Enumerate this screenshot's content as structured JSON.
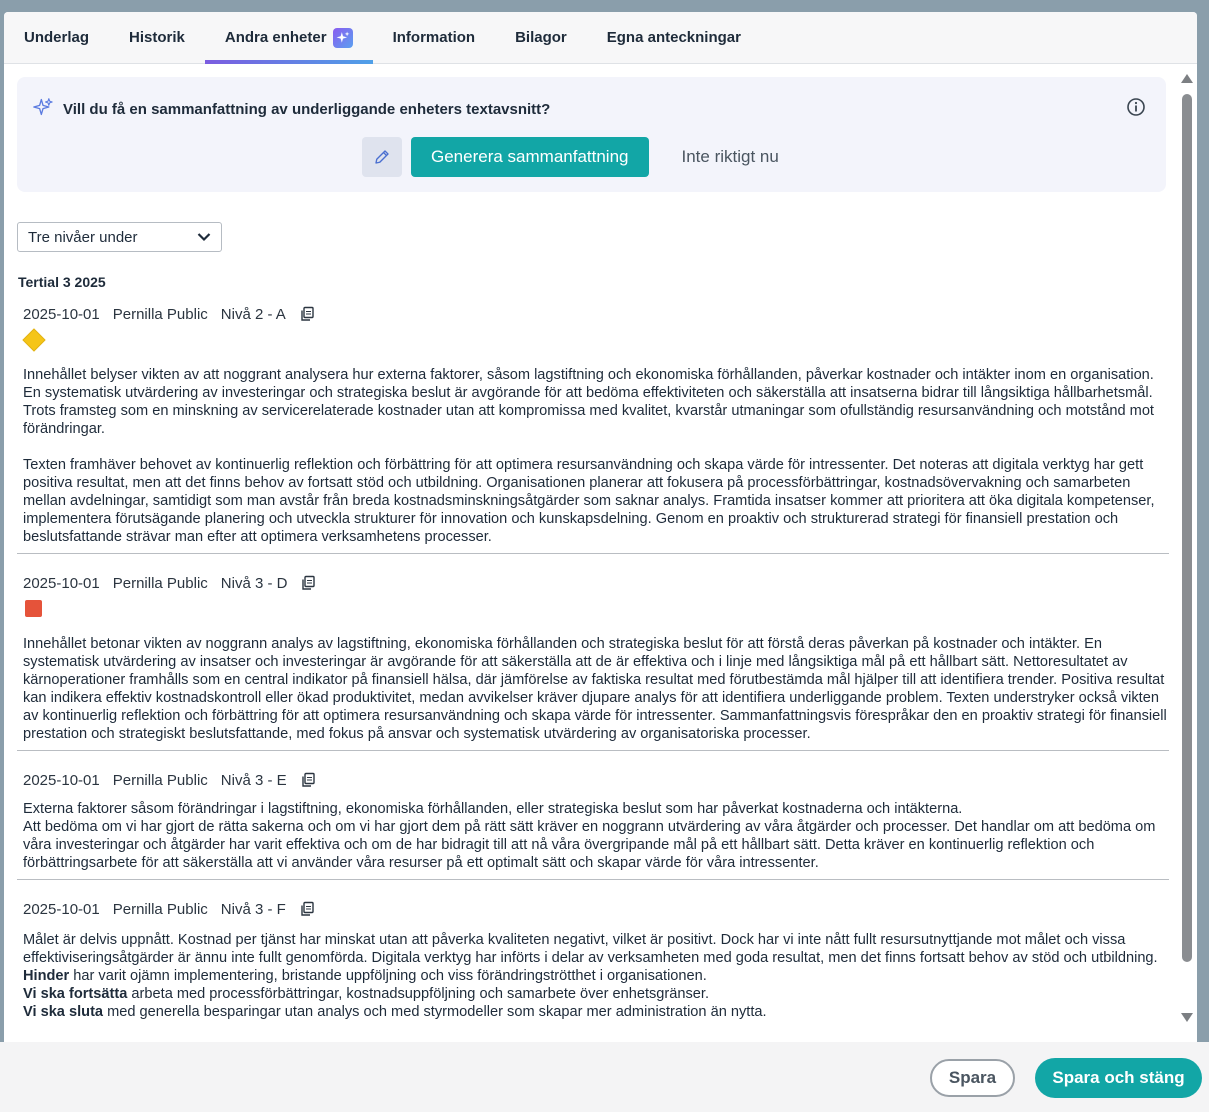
{
  "tabs": [
    {
      "label": "Underlag"
    },
    {
      "label": "Historik"
    },
    {
      "label": "Andra enheter"
    },
    {
      "label": "Information"
    },
    {
      "label": "Bilagor"
    },
    {
      "label": "Egna anteckningar"
    }
  ],
  "active_tab": "Andra enheter",
  "ai_prompt": {
    "question": "Vill du få en sammanfattning av underliggande enheters textavsnitt?",
    "generate_label": "Generera sammanfattning",
    "dismiss_label": "Inte riktigt nu"
  },
  "level_select": {
    "value": "Tre nivåer under"
  },
  "period_title": "Tertial 3 2025",
  "entries": [
    {
      "date": "2025-10-01",
      "author": "Pernilla Public",
      "unit": "Nivå 2 - A",
      "status_color": "#f5c518",
      "p1": "Innehållet belyser vikten av att noggrant analysera hur externa faktorer, såsom lagstiftning och ekonomiska förhållanden, påverkar kostnader och intäkter inom en organisation. En systematisk utvärdering av investeringar och strategiska beslut är avgörande för att bedöma effektiviteten och säkerställa att insatserna bidrar till långsiktiga hållbarhetsmål. Trots framsteg som en minskning av servicerelaterade kostnader utan att kompromissa med kvalitet, kvarstår utmaningar som ofullständig resursanvändning och motstånd mot förändringar.",
      "p2": "Texten framhäver behovet av kontinuerlig reflektion och förbättring för att optimera resursanvändning och skapa värde för intressenter. Det noteras att digitala verktyg har gett positiva resultat, men att det finns behov av fortsatt stöd och utbildning. Organisationen planerar att fokusera på processförbättringar, kostnadsövervakning och samarbeten mellan avdelningar, samtidigt som man avstår från breda kostnadsminskningsåtgärder som saknar analys. Framtida insatser kommer att prioritera att öka digitala kompetenser, implementera förutsägande planering och utveckla strukturer för innovation och kunskapsdelning. Genom en proaktiv och strukturerad strategi för finansiell prestation och beslutsfattande strävar man efter att optimera verksamhetens processer."
    },
    {
      "date": "2025-10-01",
      "author": "Pernilla Public",
      "unit": "Nivå 3 - D",
      "status_color": "#e5533a",
      "p1": "Innehållet betonar vikten av noggrann analys av lagstiftning, ekonomiska förhållanden och strategiska beslut för att förstå deras påverkan på kostnader och intäkter. En systematisk utvärdering av insatser och investeringar är avgörande för att säkerställa att de är effektiva och i linje med långsiktiga mål på ett hållbart sätt. Nettoresultatet av kärnoperationer framhålls som en central indikator på finansiell hälsa, där jämförelse av faktiska resultat med förutbestämda mål hjälper till att identifiera trender. Positiva resultat kan indikera effektiv kostnadskontroll eller ökad produktivitet, medan avvikelser kräver djupare analys för att identifiera underliggande problem. Texten understryker också vikten av kontinuerlig reflektion och förbättring för att optimera resursanvändning och skapa värde för intressenter. Sammanfattningsvis förespråkar den en proaktiv strategi för finansiell prestation och strategiskt beslutsfattande, med fokus på ansvar och systematisk utvärdering av organisatoriska processer."
    },
    {
      "date": "2025-10-01",
      "author": "Pernilla Public",
      "unit": "Nivå 3 - E",
      "p1": "Externa faktorer såsom förändringar i lagstiftning, ekonomiska förhållanden, eller strategiska beslut som har påverkat kostnaderna och intäkterna.",
      "p2": "Att bedöma om vi har gjort de rätta sakerna och om vi har gjort dem på rätt sätt kräver en noggrann utvärdering av våra åtgärder och processer. Det handlar om att bedöma om våra investeringar och åtgärder har varit effektiva och om de har bidragit till att nå våra övergripande mål på ett hållbart sätt. Detta kräver en kontinuerlig reflektion och förbättringsarbete för att säkerställa att vi använder våra resurser på ett optimalt sätt och skapar värde för våra intressenter."
    },
    {
      "date": "2025-10-01",
      "author": "Pernilla Public",
      "unit": "Nivå 3 - F",
      "p1": "Målet är delvis uppnått. Kostnad per tjänst har minskat utan att påverka kvaliteten negativt, vilket är positivt. Dock har vi inte nått fullt resursutnyttjande mot målet och vissa effektiviseringsåtgärder är ännu inte fullt genomförda. Digitala verktyg har införts i delar av verksamheten med goda resultat, men det finns fortsatt behov av stöd och utbildning.",
      "l1_bold": "Hinder",
      "l1_rest": " har varit ojämn implementering, bristande uppföljning och viss förändringströtthet i organisationen.",
      "l2_bold": "Vi ska fortsätta",
      "l2_rest": " arbeta med processförbättringar, kostnadsuppföljning och samarbete över enhetsgränser.",
      "l3_bold": "Vi ska sluta",
      "l3_rest": " med generella besparingar utan analys och med styrmodeller som skapar mer administration än nytta."
    }
  ],
  "footer": {
    "save_label": "Spara",
    "save_close_label": "Spara och stäng"
  },
  "colors": {
    "accent": "#12a6a6",
    "tab_underline_start": "#7b5ce0",
    "tab_underline_end": "#4fa0e8"
  }
}
